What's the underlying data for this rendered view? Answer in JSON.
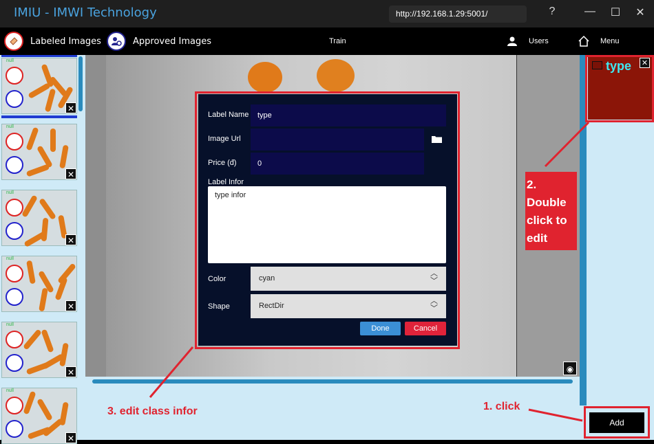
{
  "window": {
    "title": "IMIU - IMWI Technology",
    "url": "http://192.168.1.29:5001/",
    "help": "?",
    "minimize": "—",
    "maximize": "☐",
    "close": "✕"
  },
  "nav": {
    "labeled": "Labeled Images",
    "approved": "Approved Images",
    "train": "Train",
    "users": "Users",
    "menu": "Menu"
  },
  "thumbnails": {
    "tag": "null",
    "count": 6,
    "close": "✕"
  },
  "class_card": {
    "name": "type",
    "close": "✕"
  },
  "dialog": {
    "label_name_label": "Label Name",
    "label_name_value": "type",
    "image_url_label": "Image Url",
    "image_url_value": "",
    "price_label": "Price (đ)",
    "price_value": "0",
    "infor_label": "Label Infor",
    "infor_value": "type infor",
    "color_label": "Color",
    "color_value": "cyan",
    "shape_label": "Shape",
    "shape_value": "RectDir",
    "done": "Done",
    "cancel": "Cancel"
  },
  "add_button": "Add",
  "annotations": {
    "step1": "1. click",
    "step2_lines": [
      "2.",
      "Double",
      "click to",
      "edit"
    ],
    "step3": "3. edit class infor"
  },
  "colors": {
    "accent_blue": "#2a8bbd",
    "annotation_red": "#e0232f",
    "panel_bg": "#cfeaf7",
    "class_card": "#8b1508",
    "class_text": "#3ee8f2"
  }
}
